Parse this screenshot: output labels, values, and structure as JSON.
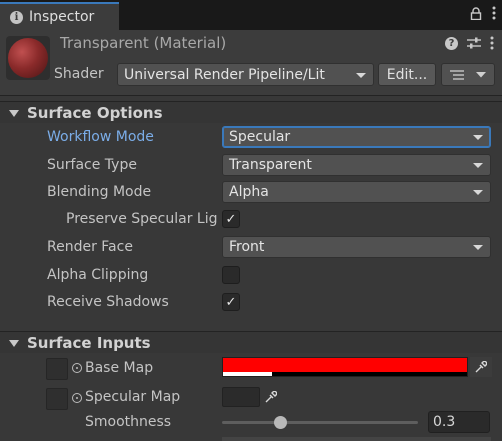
{
  "tab": {
    "title": "Inspector"
  },
  "header": {
    "material_title": "Transparent (Material)",
    "shader_label": "Shader",
    "shader_value": "Universal Render Pipeline/Lit",
    "edit_label": "Edit..."
  },
  "surface_options": {
    "title": "Surface Options",
    "workflow_mode": {
      "label": "Workflow Mode",
      "value": "Specular"
    },
    "surface_type": {
      "label": "Surface Type",
      "value": "Transparent"
    },
    "blending_mode": {
      "label": "Blending Mode",
      "value": "Alpha"
    },
    "preserve_specular": {
      "label": "Preserve Specular Lig",
      "checked": true
    },
    "render_face": {
      "label": "Render Face",
      "value": "Front"
    },
    "alpha_clipping": {
      "label": "Alpha Clipping",
      "checked": false
    },
    "receive_shadows": {
      "label": "Receive Shadows",
      "checked": true
    }
  },
  "surface_inputs": {
    "title": "Surface Inputs",
    "base_map": {
      "label": "Base Map",
      "color": "#ff0000",
      "alpha": 0.2
    },
    "specular_map": {
      "label": "Specular Map"
    },
    "smoothness": {
      "label": "Smoothness",
      "value": "0.3",
      "fraction": 0.3
    }
  },
  "colors": {
    "accent": "#3a79bb",
    "active_label": "#7bade8"
  },
  "icons": [
    "info-icon",
    "lock-icon",
    "menu-icon",
    "help-icon",
    "preset-icon",
    "more-icon",
    "dropdown-caret-icon",
    "list-icon",
    "checkmark-icon",
    "eyedropper-icon"
  ]
}
